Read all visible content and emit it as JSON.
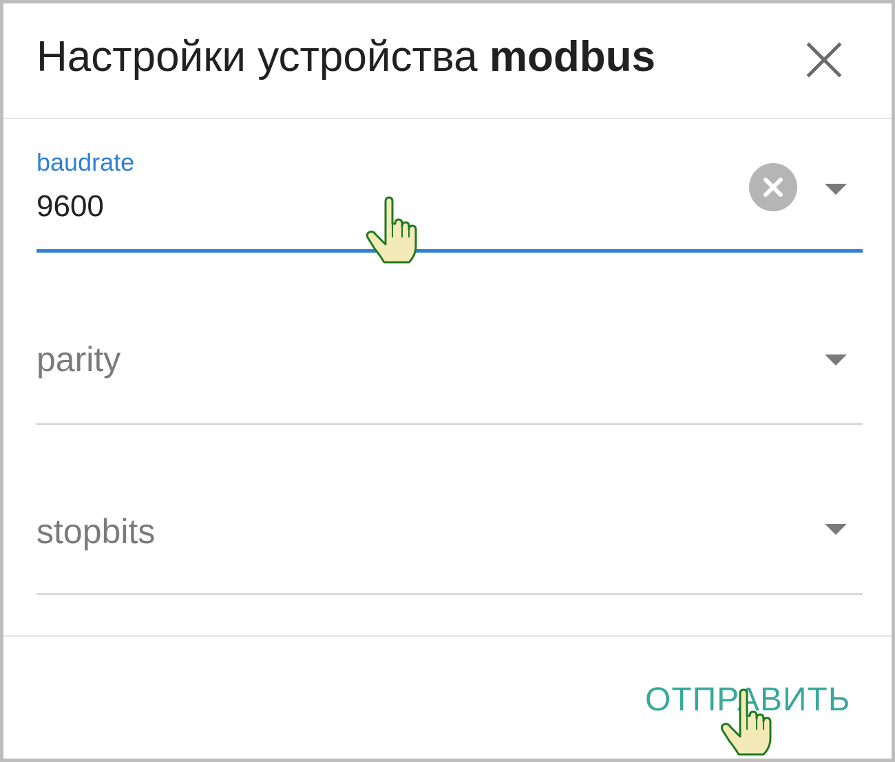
{
  "dialog": {
    "title_prefix": "Настройки устройства",
    "title_device": "modbus",
    "close_icon": "close-icon"
  },
  "fields": {
    "baudrate": {
      "label": "baudrate",
      "value": "9600",
      "clear_icon": "clear-circle-icon",
      "arrow_icon": "dropdown-arrow-icon"
    },
    "parity": {
      "placeholder": "parity",
      "arrow_icon": "dropdown-arrow-icon"
    },
    "stopbits": {
      "placeholder": "stopbits",
      "arrow_icon": "dropdown-arrow-icon"
    }
  },
  "footer": {
    "submit_label": "ОТПРАВИТЬ"
  },
  "colors": {
    "accent_blue": "#2f7fd6",
    "submit_teal": "#3aa89a",
    "cursor_fill": "#f3eab8",
    "cursor_outline": "#1f7a1f"
  }
}
